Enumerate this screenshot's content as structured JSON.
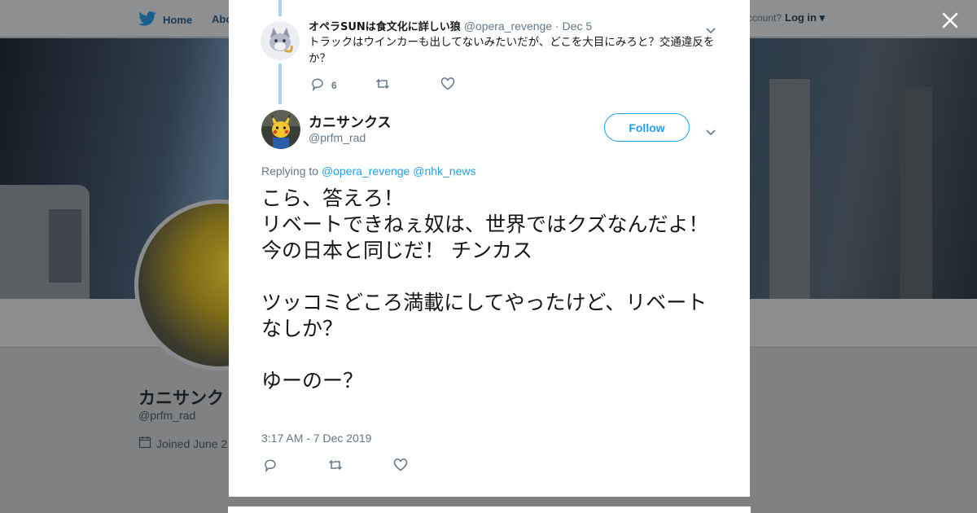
{
  "background_page": {
    "nav_home": "Home",
    "nav_about": "Abo",
    "account_prompt": "ccount?",
    "login_label": "Log in",
    "profile_name": "カニサンク",
    "profile_handle": "@prfm_rad",
    "joined_text": "Joined June 2"
  },
  "reply_tweet": {
    "author_name": "オペラSUNは食文化に詳しい狼",
    "author_handle": "@opera_revenge",
    "date": "· Dec 5",
    "text": "トラックはウインカーも出してないみたいだが、どこを大目にみろと？交通違反をか？",
    "reply_count": "6",
    "retweet_count": "",
    "like_count": ""
  },
  "main_tweet": {
    "author_name": "カニサンクス",
    "author_handle": "@prfm_rad",
    "follow_label": "Follow",
    "replying_prefix": "Replying to",
    "replying_to_1": "@opera_revenge",
    "replying_to_2": "@nhk_news",
    "lines": [
      "こら、答えろ！",
      "リベートできねぇ奴は、世界ではクズなんだよ！",
      "今の日本と同じだ！ チンカス",
      "",
      "ツッコミどころ満載にしてやったけど、リベートなしか？",
      "",
      "ゆーのー？"
    ],
    "timestamp": "3:17 AM - 7 Dec 2019"
  },
  "colors": {
    "accent": "#1da1f2",
    "thread_line": "#a9d4f5",
    "secondary_text": "#657786",
    "overlay": "#7f8183"
  },
  "icons": [
    "twitter-bird-icon",
    "calendar-icon",
    "close-icon",
    "chevron-down-icon",
    "reply-icon",
    "retweet-icon",
    "like-icon"
  ]
}
